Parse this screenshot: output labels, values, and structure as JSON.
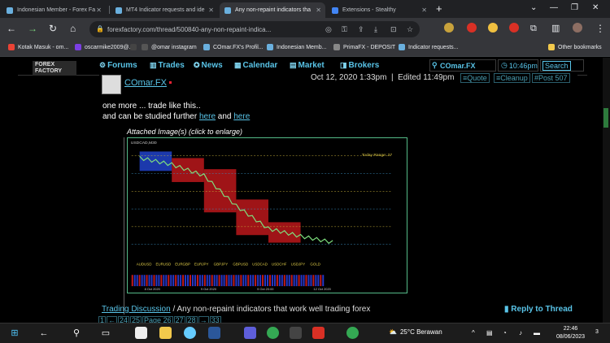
{
  "browser": {
    "tabs": [
      {
        "title": "Indonesian Member - Forex Fa",
        "active": false,
        "favicon_color": "#6ab0de"
      },
      {
        "title": "MT4 Indicator requests and ide",
        "active": false,
        "favicon_color": "#6ab0de"
      },
      {
        "title": "Any non-repaint indicators tha",
        "active": true,
        "favicon_color": "#6ab0de"
      },
      {
        "title": "Extensions - Stealthy",
        "active": false,
        "favicon_color": "#4285f4"
      }
    ],
    "new_tab": "+",
    "url": "forexfactory.com/thread/500840-any-non-repaint-indica...",
    "window_controls": [
      "⌄",
      "—",
      "❐",
      "✕"
    ]
  },
  "bookmarks": [
    {
      "label": "Kotak Masuk - om...",
      "color": "#ea4335"
    },
    {
      "label": "oscarmike2009@...",
      "color": "#7b3fe4"
    },
    {
      "label": "",
      "color": "#444"
    },
    {
      "label": "@omar instagram",
      "color": "#555"
    },
    {
      "label": "COmar.FX's Profil...",
      "color": "#6ab0de"
    },
    {
      "label": "Indonesian Memb...",
      "color": "#6ab0de"
    },
    {
      "label": "PrimaFX - DEPOSIT",
      "color": "#888"
    },
    {
      "label": "Indicator requests...",
      "color": "#6ab0de"
    }
  ],
  "other_bookmarks": "Other bookmarks",
  "forum_nav": {
    "logo": "FOREX FACTORY",
    "items": [
      "Forums",
      "Trades",
      "News",
      "Calendar",
      "Market",
      "Brokers"
    ],
    "user": "COmar.FX",
    "time": "10:46pm",
    "search": "Search"
  },
  "post": {
    "username": "COmar.FX",
    "date": "Oct 12, 2020 1:33pm",
    "edited": "Edited 11:49pm",
    "actions": [
      "Quote",
      "Cleanup",
      "Post 507"
    ],
    "line1": "one more ... trade like this..",
    "line2_prefix": "and can be studied further",
    "link1": "here",
    "and": "and",
    "link2": "here",
    "attach_label": "Attached Image(s) (click to enlarge)"
  },
  "chart_data": {
    "type": "line",
    "title": "USDCAD,M30",
    "annotation": "Today Range: 27",
    "symbol_tabs": [
      "AUDUSD",
      "EURUSD",
      "EURGBP",
      "EURJPY",
      "GBPJPY",
      "GBPUSD",
      "USDCAD",
      "USDCHF",
      "USDJPY",
      "GOLD"
    ],
    "x": [
      "8 Oct 2020",
      "9 Oct 2020",
      "9 Oct 20:00",
      "12 Oct 2020"
    ],
    "series": [
      {
        "name": "USDCAD",
        "values": [
          1.3275,
          1.3262,
          1.324,
          1.318,
          1.3135,
          1.312,
          1.3108
        ]
      }
    ]
  },
  "footer": {
    "breadcrumb_link": "Trading Discussion",
    "separator": "/",
    "thread": "Any non-repaint indicators that work well trading forex",
    "reply": "Reply to Thread",
    "pager": [
      "1",
      "←",
      "24",
      "25",
      "Page 26",
      "27",
      "28",
      "→",
      "33"
    ]
  },
  "taskbar": {
    "weather": "25°C  Berawan",
    "time": "22:46",
    "date": "08/06/2023",
    "notif": "3"
  }
}
